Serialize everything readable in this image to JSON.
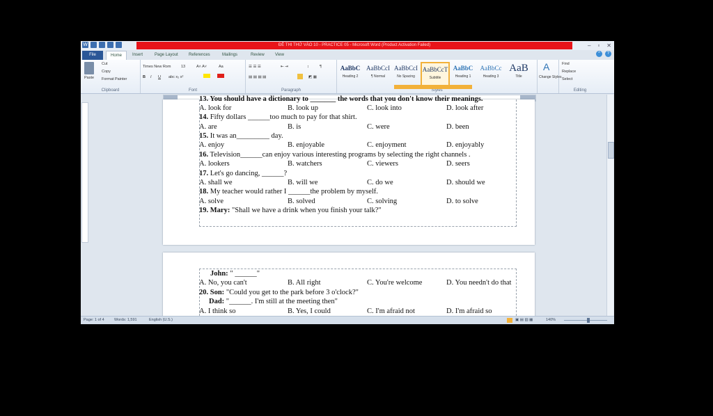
{
  "window": {
    "title": "ĐỀ THI THỬ VÀO 10 - PRACTICE 05 - Microsoft Word (Product Activation Failed)"
  },
  "tabs": [
    "File",
    "Home",
    "Insert",
    "Page Layout",
    "References",
    "Mailings",
    "Review",
    "View"
  ],
  "ribbon": {
    "clipboard": {
      "paste": "Paste",
      "cut": "Cut",
      "copy": "Copy",
      "format_painter": "Format Painter",
      "label": "Clipboard"
    },
    "font": {
      "name": "Times New Rom",
      "size": "13",
      "label": "Font"
    },
    "paragraph": {
      "label": "Paragraph"
    },
    "styles": {
      "items": [
        {
          "preview": "AaBbC",
          "name": "Heading 2"
        },
        {
          "preview": "AaBbCcI",
          "name": "¶ Normal"
        },
        {
          "preview": "AaBbCcI",
          "name": "No Spacing"
        },
        {
          "preview": "AaBbCcT",
          "name": "Subtitle"
        },
        {
          "preview": "AaBbC",
          "name": "Heading 1"
        },
        {
          "preview": "AaBbCc",
          "name": "Heading 3"
        },
        {
          "preview": "AaB",
          "name": "Title"
        }
      ],
      "change_styles": "Change Styles",
      "label": "Styles"
    },
    "editing": {
      "find": "Find",
      "replace": "Replace",
      "select": "Select",
      "label": "Editing"
    }
  },
  "document": {
    "page1": {
      "q13_tail": "13. You should have a dictionary to _______ the words that you don't know their meanings.",
      "q13_opts": [
        "A. look for",
        "B. look up",
        "C. look into",
        "D. look after"
      ],
      "q14": {
        "num": "14.",
        "text": " Fifty dollars ______too much to pay for that shirt."
      },
      "q14_opts": [
        "A. are",
        "B. is",
        "C. were",
        "D. been"
      ],
      "q15": {
        "num": "15.",
        "text": " It was an_________ day."
      },
      "q15_opts": [
        "A. enjoy",
        "B. enjoyable",
        "C. enjoyment",
        "D. enjoyably"
      ],
      "q16": {
        "num": "16.",
        "text": " Television______can enjoy various interesting programs by selecting the right channels ."
      },
      "q16_opts": [
        "A. lookers",
        "B. watchers",
        "C. viewers",
        "D. seers"
      ],
      "q17": {
        "num": "17.",
        "text": " Let's go dancing, ______?"
      },
      "q17_opts": [
        "A. shall we",
        "B. will we",
        "C. do we",
        "D. should we"
      ],
      "q18": {
        "num": "18.",
        "text": " My teacher would rather I ______the problem by myself."
      },
      "q18_opts": [
        "A. solve",
        "B. solved",
        "C. solving",
        "D. to solve"
      ],
      "q19": {
        "num": "19. Mary:",
        "text": " \"Shall we have a drink when you finish your talk?\""
      }
    },
    "page2": {
      "john": {
        "speaker": "John:",
        "text": " \" ______\""
      },
      "q19_opts": [
        "A. No, you can't",
        "B. All right",
        "C. You're welcome",
        "D. You needn't do that"
      ],
      "q20": {
        "num": "20. Son:",
        "text": " \"Could you get to the park before 3 o'clock?\""
      },
      "dad": {
        "speaker": "Dad:",
        "text": " \"______. I'm still at the meeting then\""
      },
      "q20_opts": [
        "A. I think so",
        "B. Yes, I could",
        "C. I'm afraid not",
        "D. I'm afraid so"
      ]
    }
  },
  "status": {
    "page": "Page: 1 of 4",
    "words": "Words: 1,591",
    "language": "English (U.S.)",
    "zoom": "140%"
  }
}
